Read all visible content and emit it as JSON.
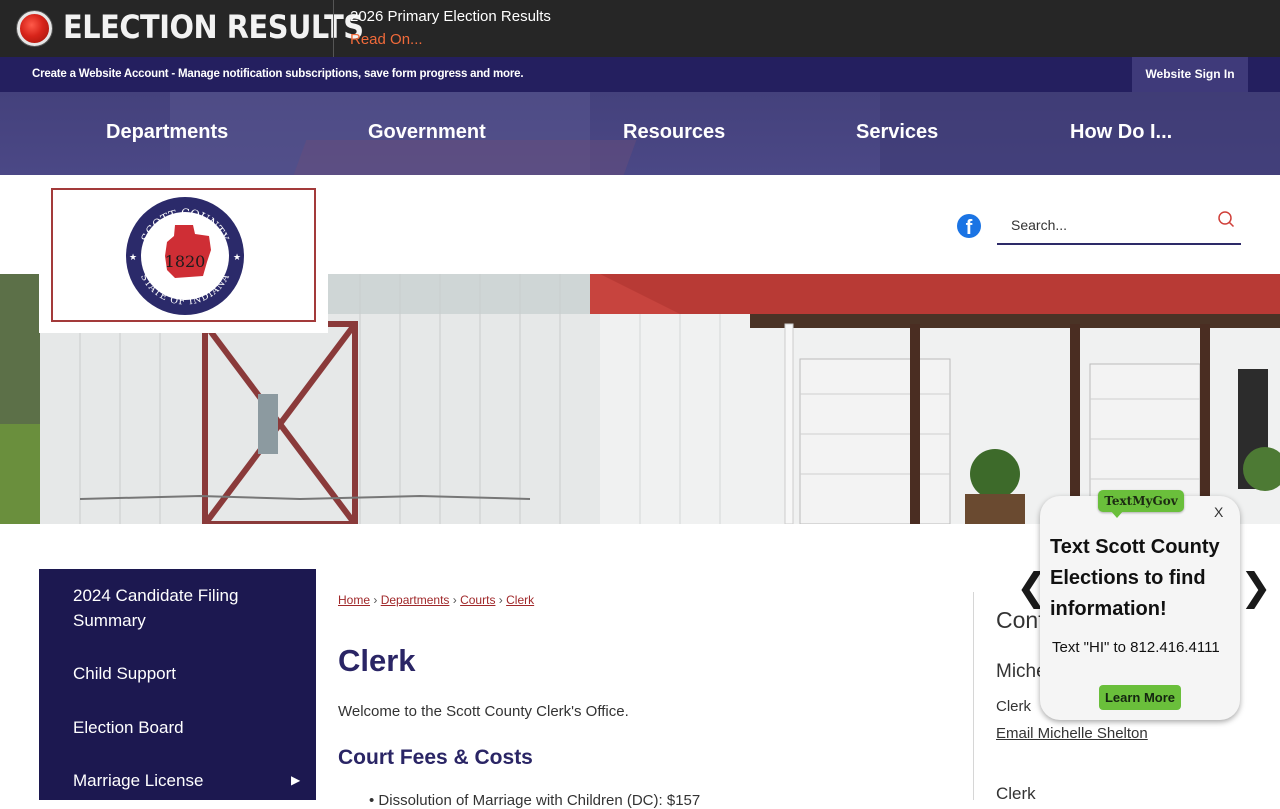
{
  "alert": {
    "title": "ELECTION RESULTS",
    "headline": "2026 Primary Election Results",
    "link": "Read On..."
  },
  "account": {
    "text": "Create a Website Account - Manage notification subscriptions, save form progress and more.",
    "signin": "Website Sign In"
  },
  "nav": {
    "items": [
      "Departments",
      "Government",
      "Resources",
      "Services",
      "How Do I..."
    ]
  },
  "logo": {
    "arc_top": "SCOTT COUNTY",
    "year": "1820",
    "arc_bottom": "STATE OF INDIANA"
  },
  "search": {
    "placeholder": "Search..."
  },
  "sidebar": {
    "items": [
      "2024 Candidate Filing Summary",
      "Child Support",
      "Election Board",
      "Marriage License"
    ]
  },
  "breadcrumb": {
    "items": [
      "Home",
      "Departments",
      "Courts",
      "Clerk"
    ],
    "separator": "›"
  },
  "main": {
    "title": "Clerk",
    "welcome": "Welcome to the Scott County Clerk's Office.",
    "section_title": "Court Fees & Costs",
    "fee_item": "Dissolution of Marriage with Children (DC): $157"
  },
  "contact": {
    "title": "Contact Us",
    "name": "Michelle Shelton",
    "role": "Clerk",
    "email_link": "Email Michelle Shelton",
    "sub_title": "Clerk"
  },
  "popup": {
    "badge": "TextMyGov",
    "close": "X",
    "heading": "Text Scott County Elections to find information!",
    "body": "Text \"HI\" to 812.416.4111",
    "button": "Learn More",
    "prev": "❮",
    "next": "❯"
  },
  "colors": {
    "alert_bg": "#262626",
    "account_bg": "#241f5f",
    "nav_bg": "#46437f",
    "sidebar_bg": "#1c1850",
    "title_color": "#2a2565",
    "link_red": "#a0282a",
    "popup_green": "#6abf3b"
  }
}
